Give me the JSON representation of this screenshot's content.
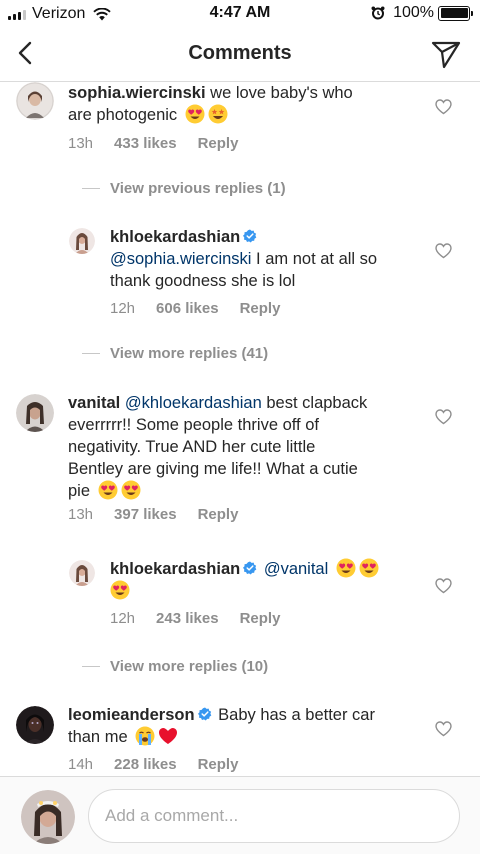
{
  "status_bar": {
    "carrier": "Verizon",
    "time": "4:47 AM",
    "battery": "100%"
  },
  "header": {
    "title": "Comments"
  },
  "comments": [
    {
      "username": "sophia.wiercinski",
      "text_line1": "we love baby's who",
      "text_line2": "are photogenic",
      "time": "13h",
      "likes": "433 likes",
      "reply": "Reply"
    },
    {
      "username": "khloekardashian",
      "mention": "@sophia.wiercinski",
      "text_line1": " I am not at all so",
      "text_line2": "thank goodness she is lol",
      "time": "12h",
      "likes": "606 likes",
      "reply": "Reply"
    },
    {
      "username": "vanital",
      "mention": "@khloekardashian",
      "text_line1": " best clapback",
      "text_line2": "everrrrr!! Some people thrive off of",
      "text_line3": "negativity. True AND her cute little",
      "text_line4": "Bentley are giving me life!! What a cutie",
      "text_line5": "pie",
      "time": "13h",
      "likes": "397 likes",
      "reply": "Reply"
    },
    {
      "username": "khloekardashian",
      "mention": "@vanital",
      "time": "12h",
      "likes": "243 likes",
      "reply": "Reply"
    },
    {
      "username": "leomieanderson",
      "text_line1": "Baby has a better car",
      "text_line2": "than me",
      "time": "14h",
      "likes": "228 likes",
      "reply": "Reply"
    }
  ],
  "view_replies": [
    "View previous replies (1)",
    "View more replies (41)",
    "View more replies (10)"
  ],
  "input": {
    "placeholder": "Add a comment..."
  },
  "colors": {
    "text": "#262626",
    "secondary": "#8e8e8e",
    "mention": "#003569",
    "verified": "#3897f0",
    "divider": "#dbdbdb"
  },
  "icons": [
    "back-arrow-icon",
    "send-icon",
    "heart-icon",
    "verified-badge-icon",
    "heart-eyes-emoji",
    "star-struck-emoji",
    "crying-emoji",
    "red-heart-emoji"
  ]
}
